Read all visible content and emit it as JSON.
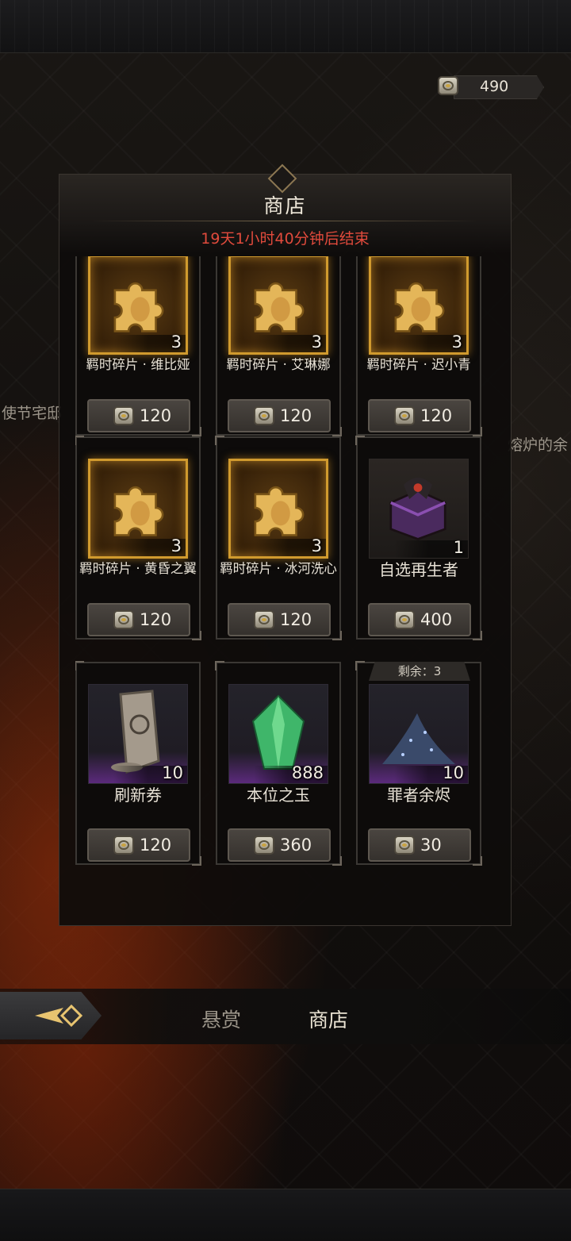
{
  "currency": {
    "amount": "490"
  },
  "background_labels": [
    "使节宅邸",
    "熔炉的余"
  ],
  "shop": {
    "title": "商店",
    "countdown": "19天1小时40分钟后结束",
    "items": [
      {
        "name": "羁时碎片 · 维比娅",
        "qty": "3",
        "price": "120",
        "icon": "puzzle-piece-icon",
        "style": "gold"
      },
      {
        "name": "羁时碎片 · 艾琳娜",
        "qty": "3",
        "price": "120",
        "icon": "puzzle-piece-icon",
        "style": "gold"
      },
      {
        "name": "羁时碎片 · 迟小青",
        "qty": "3",
        "price": "120",
        "icon": "puzzle-piece-icon",
        "style": "gold"
      },
      {
        "name": "羁时碎片 · 黄昏之翼",
        "qty": "3",
        "price": "120",
        "icon": "puzzle-piece-icon",
        "style": "gold"
      },
      {
        "name": "羁时碎片 · 冰河洗心",
        "qty": "3",
        "price": "120",
        "icon": "puzzle-piece-icon",
        "style": "gold"
      },
      {
        "name": "自选再生者",
        "qty": "1",
        "price": "400",
        "icon": "chest-icon",
        "style": "dark"
      },
      {
        "name": "刷新券",
        "qty": "10",
        "price": "120",
        "icon": "scroll-icon",
        "style": "purple"
      },
      {
        "name": "本位之玉",
        "qty": "888",
        "price": "360",
        "icon": "gem-icon",
        "style": "purple"
      },
      {
        "name": "罪者余烬",
        "qty": "10",
        "price": "30",
        "icon": "dust-icon",
        "style": "purple",
        "remaining": "剩余：3"
      }
    ]
  },
  "tabs": [
    {
      "label": "悬赏",
      "active": false
    },
    {
      "label": "商店",
      "active": true
    }
  ],
  "colors": {
    "countdown": "#e04a3c",
    "gold_frame": "#d09a2e",
    "rare_purple": "#5b2a7c"
  }
}
